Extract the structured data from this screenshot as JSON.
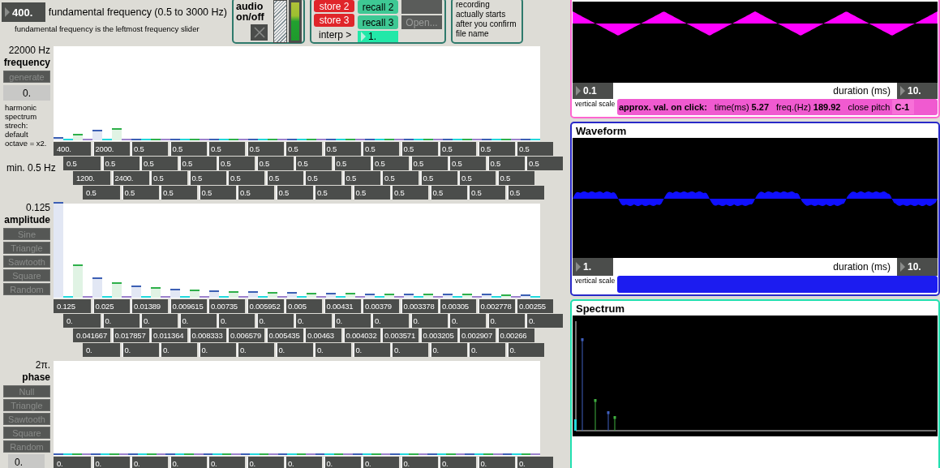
{
  "fundamental": {
    "value": "400.",
    "label": "fundamental frequency (0.5 to 3000 Hz)",
    "caption": "fundamental frequency is the leftmost frequency slider"
  },
  "audio": {
    "label": "audio on/off",
    "on": false,
    "meter": {
      "level": 1
    }
  },
  "presets": {
    "store": [
      {
        "label": "store 2"
      },
      {
        "label": "store 3"
      }
    ],
    "recall": [
      {
        "label": "recall 2"
      },
      {
        "label": "recall 3"
      }
    ],
    "interp_label": "interp >",
    "interp_value": "1.",
    "open": {
      "label": "Open...",
      "disabled": true
    }
  },
  "recording_note": "recording actually starts after you confirm file name",
  "sections": [
    {
      "max_label": "22000 Hz",
      "title": "frequency",
      "buttons": [
        {
          "label": "generate",
          "disabled": true
        }
      ],
      "side_value": "0.",
      "caption": "harmonic spectrum strech: default octave = x2.",
      "min_label": "min. 0.5 Hz",
      "rows": [
        {
          "color": "#3c5fb4",
          "boxes": [
            {
              "value": "400.",
              "level": 0.018
            },
            {
              "value": "2000.",
              "level": 0.091
            },
            {
              "value": "0.5",
              "level": 0
            },
            {
              "value": "0.5",
              "level": 0
            },
            {
              "value": "0.5",
              "level": 0
            },
            {
              "value": "0.5",
              "level": 0
            },
            {
              "value": "0.5",
              "level": 0
            },
            {
              "value": "0.5",
              "level": 0
            },
            {
              "value": "0.5",
              "level": 0
            },
            {
              "value": "0.5",
              "level": 0
            },
            {
              "value": "0.5",
              "level": 0
            },
            {
              "value": "0.5",
              "level": 0
            },
            {
              "value": "0.5",
              "level": 0
            }
          ]
        },
        {
          "color": "#22d8dc",
          "boxes": [
            {
              "value": "0.5",
              "level": 0
            },
            {
              "value": "0.5",
              "level": 0
            },
            {
              "value": "0.5",
              "level": 0
            },
            {
              "value": "0.5",
              "level": 0
            },
            {
              "value": "0.5",
              "level": 0
            },
            {
              "value": "0.5",
              "level": 0
            },
            {
              "value": "0.5",
              "level": 0
            },
            {
              "value": "0.5",
              "level": 0
            },
            {
              "value": "0.5",
              "level": 0
            },
            {
              "value": "0.5",
              "level": 0
            },
            {
              "value": "0.5",
              "level": 0
            },
            {
              "value": "0.5",
              "level": 0
            },
            {
              "value": "0.5",
              "level": 0
            }
          ]
        },
        {
          "color": "#2eb04a",
          "boxes": [
            {
              "value": "1200.",
              "level": 0.055
            },
            {
              "value": "2400.",
              "level": 0.109
            },
            {
              "value": "0.5",
              "level": 0
            },
            {
              "value": "0.5",
              "level": 0
            },
            {
              "value": "0.5",
              "level": 0
            },
            {
              "value": "0.5",
              "level": 0
            },
            {
              "value": "0.5",
              "level": 0
            },
            {
              "value": "0.5",
              "level": 0
            },
            {
              "value": "0.5",
              "level": 0
            },
            {
              "value": "0.5",
              "level": 0
            },
            {
              "value": "0.5",
              "level": 0
            },
            {
              "value": "0.5",
              "level": 0
            }
          ]
        },
        {
          "color": "#9c82cc",
          "boxes": [
            {
              "value": "0.5",
              "level": 0
            },
            {
              "value": "0.5",
              "level": 0
            },
            {
              "value": "0.5",
              "level": 0
            },
            {
              "value": "0.5",
              "level": 0
            },
            {
              "value": "0.5",
              "level": 0
            },
            {
              "value": "0.5",
              "level": 0
            },
            {
              "value": "0.5",
              "level": 0
            },
            {
              "value": "0.5",
              "level": 0
            },
            {
              "value": "0.5",
              "level": 0
            },
            {
              "value": "0.5",
              "level": 0
            },
            {
              "value": "0.5",
              "level": 0
            },
            {
              "value": "0.5",
              "level": 0
            }
          ]
        }
      ]
    },
    {
      "max_label": "0.125",
      "title": "amplitude",
      "buttons": [
        {
          "label": "Sine",
          "disabled": true
        },
        {
          "label": "Triangle",
          "disabled": true
        },
        {
          "label": "Sawtooth",
          "disabled": true
        },
        {
          "label": "Square",
          "disabled": true
        },
        {
          "label": "Random",
          "disabled": true
        }
      ],
      "rows": [
        {
          "color": "#3c5fb4",
          "boxes": [
            {
              "value": "0.125",
              "level": 1
            },
            {
              "value": "0.025",
              "level": 0.2
            },
            {
              "value": "0.01389",
              "level": 0.111
            },
            {
              "value": "0.009615",
              "level": 0.077
            },
            {
              "value": "0.00735",
              "level": 0.059
            },
            {
              "value": "0.005952",
              "level": 0.048
            },
            {
              "value": "0.005",
              "level": 0.04
            },
            {
              "value": "0.00431",
              "level": 0.034
            },
            {
              "value": "0.00379",
              "level": 0.03
            },
            {
              "value": "0.003378",
              "level": 0.027
            },
            {
              "value": "0.00305",
              "level": 0.024
            },
            {
              "value": "0.002778",
              "level": 0.022
            },
            {
              "value": "0.00255",
              "level": 0.02
            }
          ]
        },
        {
          "color": "#22d8dc",
          "boxes": [
            {
              "value": "0.",
              "level": 0
            },
            {
              "value": "0.",
              "level": 0
            },
            {
              "value": "0.",
              "level": 0
            },
            {
              "value": "0.",
              "level": 0
            },
            {
              "value": "0.",
              "level": 0
            },
            {
              "value": "0.",
              "level": 0
            },
            {
              "value": "0.",
              "level": 0
            },
            {
              "value": "0.",
              "level": 0
            },
            {
              "value": "0.",
              "level": 0
            },
            {
              "value": "0.",
              "level": 0
            },
            {
              "value": "0.",
              "level": 0
            },
            {
              "value": "0.",
              "level": 0
            },
            {
              "value": "0.",
              "level": 0
            }
          ]
        },
        {
          "color": "#2eb04a",
          "boxes": [
            {
              "value": "0.041667",
              "level": 0.333
            },
            {
              "value": "0.017857",
              "level": 0.143
            },
            {
              "value": "0.011364",
              "level": 0.091
            },
            {
              "value": "0.008333",
              "level": 0.067
            },
            {
              "value": "0.006579",
              "level": 0.053
            },
            {
              "value": "0.005435",
              "level": 0.043
            },
            {
              "value": "0.00463",
              "level": 0.037
            },
            {
              "value": "0.004032",
              "level": 0.032
            },
            {
              "value": "0.003571",
              "level": 0.029
            },
            {
              "value": "0.003205",
              "level": 0.026
            },
            {
              "value": "0.002907",
              "level": 0.023
            },
            {
              "value": "0.00266",
              "level": 0.021
            }
          ]
        },
        {
          "color": "#9c82cc",
          "boxes": [
            {
              "value": "0.",
              "level": 0
            },
            {
              "value": "0.",
              "level": 0
            },
            {
              "value": "0.",
              "level": 0
            },
            {
              "value": "0.",
              "level": 0
            },
            {
              "value": "0.",
              "level": 0
            },
            {
              "value": "0.",
              "level": 0
            },
            {
              "value": "0.",
              "level": 0
            },
            {
              "value": "0.",
              "level": 0
            },
            {
              "value": "0.",
              "level": 0
            },
            {
              "value": "0.",
              "level": 0
            },
            {
              "value": "0.",
              "level": 0
            },
            {
              "value": "0.",
              "level": 0
            }
          ]
        }
      ]
    },
    {
      "max_label": "2π.",
      "title": "phase",
      "buttons": [
        {
          "label": "Null",
          "disabled": true
        },
        {
          "label": "Triangle",
          "disabled": true
        },
        {
          "label": "Sawtooth",
          "disabled": true
        },
        {
          "label": "Square",
          "disabled": true
        },
        {
          "label": "Random",
          "disabled": true
        }
      ],
      "bottom_value": "0.",
      "rows": [
        {
          "color": "#3c5fb4",
          "boxes": [
            {
              "value": "0.",
              "level": 0
            },
            {
              "value": "0.",
              "level": 0
            },
            {
              "value": "0.",
              "level": 0
            },
            {
              "value": "0.",
              "level": 0
            },
            {
              "value": "0.",
              "level": 0
            },
            {
              "value": "0.",
              "level": 0
            },
            {
              "value": "0.",
              "level": 0
            },
            {
              "value": "0.",
              "level": 0
            },
            {
              "value": "0.",
              "level": 0
            },
            {
              "value": "0.",
              "level": 0
            },
            {
              "value": "0.",
              "level": 0
            },
            {
              "value": "0.",
              "level": 0
            },
            {
              "value": "0.",
              "level": 0
            }
          ]
        },
        {
          "color": "#22d8dc"
        },
        {
          "color": "#2eb04a"
        },
        {
          "color": "#9c82cc"
        }
      ]
    }
  ],
  "panels": [
    {
      "kind": "triangle_scope",
      "scale": "0.1",
      "scale_label": "vertical scale",
      "duration_label": "duration (ms)",
      "duration": "10.",
      "click_info": {
        "title": "approx. val. on click:",
        "items": [
          {
            "label": "time(ms)",
            "value": "5.27"
          },
          {
            "label": "freq.(Hz)",
            "value": "189.92"
          },
          {
            "label": "close pitch",
            "value": "C-1"
          }
        ]
      }
    },
    {
      "kind": "waveform_scope",
      "title": "Waveform",
      "scale": "1.",
      "scale_label": "vertical scale",
      "duration_label": "duration (ms)",
      "duration": "10."
    },
    {
      "kind": "spectrum",
      "title": "Spectrum"
    }
  ]
}
